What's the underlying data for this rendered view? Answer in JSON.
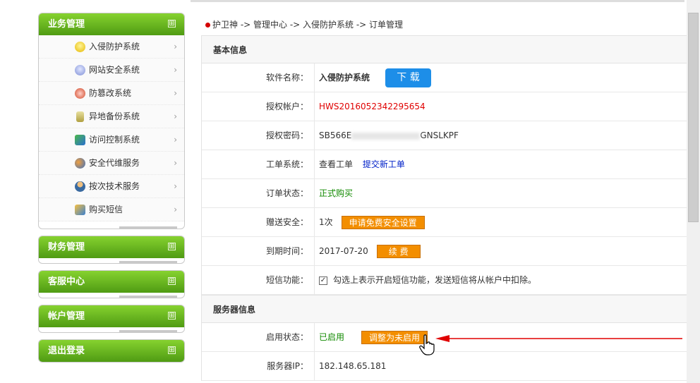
{
  "breadcrumb": "护卫神 -> 管理中心 -> 入侵防护系统 -> 订单管理",
  "sidebar": {
    "panels": [
      {
        "title": "业务管理",
        "expanded": true,
        "items": [
          {
            "label": "入侵防护系统",
            "icon": "bulb-icon"
          },
          {
            "label": "网站安全系统",
            "icon": "bulb-icon"
          },
          {
            "label": "防篡改系统",
            "icon": "shield-icon"
          },
          {
            "label": "异地备份系统",
            "icon": "database-icon"
          },
          {
            "label": "访问控制系统",
            "icon": "access-icon"
          },
          {
            "label": "安全代维服务",
            "icon": "users-icon"
          },
          {
            "label": "按次技术服务",
            "icon": "user-icon"
          },
          {
            "label": "购买短信",
            "icon": "message-icon"
          }
        ]
      },
      {
        "title": "财务管理",
        "expanded": false
      },
      {
        "title": "客服中心",
        "expanded": false
      },
      {
        "title": "帐户管理",
        "expanded": false
      },
      {
        "title": "退出登录",
        "expanded": false
      }
    ],
    "plus": "⊞"
  },
  "sections": {
    "basic": "基本信息",
    "server": "服务器信息"
  },
  "fields": {
    "software_label": "软件名称：",
    "software_value": "入侵防护系统",
    "download_btn": "下 载",
    "account_label": "授权帐户：",
    "account_value": "HWS2016052342295654",
    "password_label": "授权密码：",
    "password_prefix": "SB566E",
    "password_suffix": "GNSLKPF",
    "ticket_label": "工单系统：",
    "ticket_view": "查看工单",
    "ticket_new": "提交新工单",
    "order_label": "订单状态：",
    "order_value": "正式购买",
    "gift_label": "赠送安全：",
    "gift_value": "1次",
    "gift_btn": "申请免费安全设置",
    "expire_label": "到期时间：",
    "expire_value": "2017-07-20",
    "renew_btn": "续 费",
    "sms_label": "短信功能：",
    "sms_text": "勾选上表示开启短信功能，发送短信将从帐户中扣除。",
    "enable_label": "启用状态：",
    "enable_value": "已启用",
    "enable_btn": "调整为未启用",
    "ip_label": "服务器IP：",
    "ip_value": "182.148.65.181"
  },
  "colors": {
    "accent_green": "#5aa81a",
    "alert_red": "#e00000",
    "download_blue": "#1d8ee8",
    "button_orange": "#f38e00"
  }
}
